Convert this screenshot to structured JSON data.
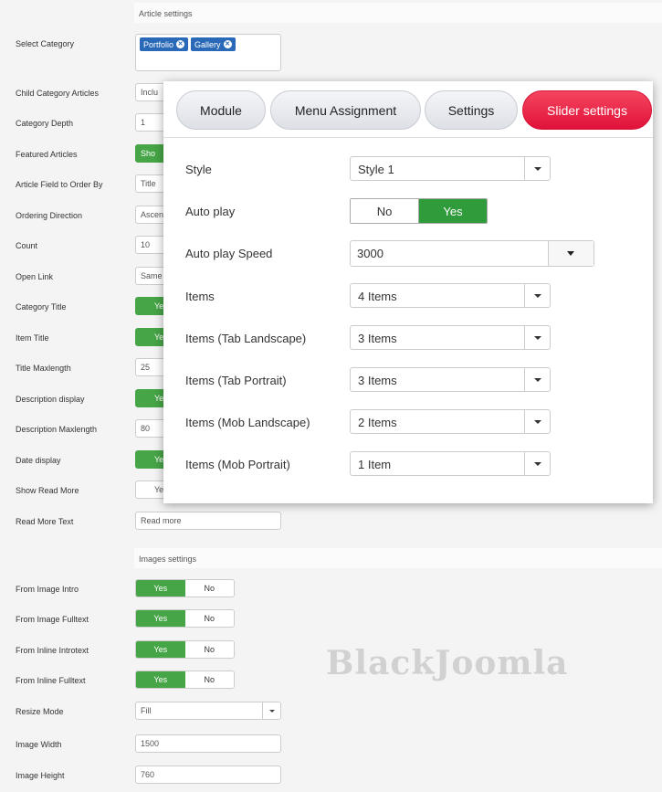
{
  "article_settings": {
    "heading": "Article settings",
    "category_label": "Select Category",
    "category_chips": [
      "Portfolio",
      "Gallery"
    ],
    "rows": [
      {
        "label": "Child Category Articles",
        "value": "Inclu"
      },
      {
        "label": "Category Depth",
        "value": "1"
      },
      {
        "label": "Featured Articles",
        "value": "Sho"
      },
      {
        "label": "Article Field to Order By",
        "value": "Title"
      },
      {
        "label": "Ordering Direction",
        "value": "Ascen"
      },
      {
        "label": "Count",
        "value": "10"
      },
      {
        "label": "Open Link",
        "value": "Same"
      },
      {
        "label": "Category Title",
        "value": "Ye"
      },
      {
        "label": "Item Title",
        "value": "Ye"
      },
      {
        "label": "Title Maxlength",
        "value": "25"
      },
      {
        "label": "Description display",
        "value": "Ye"
      },
      {
        "label": "Description Maxlength",
        "value": "80"
      },
      {
        "label": "Date display",
        "value": "Ye"
      },
      {
        "label": "Show Read More",
        "value": "Ye"
      },
      {
        "label": "Read More Text",
        "value": "Read more"
      }
    ]
  },
  "images_settings": {
    "heading": "Images settings",
    "toggles": [
      {
        "label": "From Image Intro",
        "yes": "Yes",
        "no": "No"
      },
      {
        "label": "From Image Fulltext",
        "yes": "Yes",
        "no": "No"
      },
      {
        "label": "From Inline Introtext",
        "yes": "Yes",
        "no": "No"
      },
      {
        "label": "From Inline Fulltext",
        "yes": "Yes",
        "no": "No"
      }
    ],
    "resize_mode_label": "Resize Mode",
    "resize_mode_value": "Fill",
    "image_width_label": "Image Width",
    "image_width_value": "1500",
    "image_height_label": "Image Height",
    "image_height_value": "760"
  },
  "popup": {
    "tabs": [
      "Module",
      "Menu Assignment",
      "Settings",
      "Slider settings"
    ],
    "active_tab": "Slider settings",
    "style_label": "Style",
    "style_value": "Style 1",
    "autoplay_label": "Auto play",
    "autoplay_no": "No",
    "autoplay_yes": "Yes",
    "speed_label": "Auto play Speed",
    "speed_value": "3000",
    "items_rows": [
      {
        "label": "Items",
        "value": "4 Items"
      },
      {
        "label": "Items (Tab Landscape)",
        "value": "3 Items"
      },
      {
        "label": "Items (Tab Portrait)",
        "value": "3 Items"
      },
      {
        "label": "Items (Mob Landscape)",
        "value": "2 Items"
      },
      {
        "label": "Items (Mob Portrait)",
        "value": "1 Item"
      }
    ]
  },
  "watermark": "BlackJoomla",
  "colors": {
    "toggle_on": "#46a546",
    "chip": "#2a69b8",
    "active_tab": "#e8173f"
  }
}
